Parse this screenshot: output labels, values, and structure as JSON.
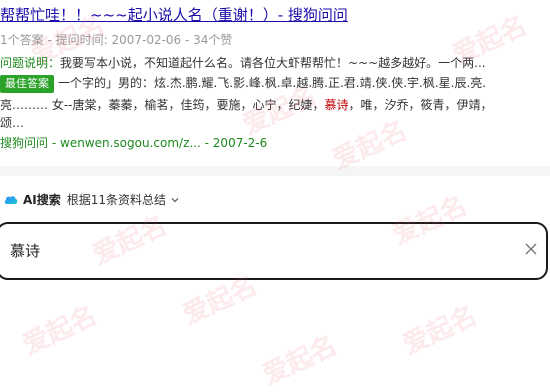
{
  "result": {
    "title": "帮帮忙哇！！~~~起小说人名（重谢！）- 搜狗问问",
    "meta": "1个答案 - 提问时间: 2007-02-06 - 34个赞",
    "question_label": "问题说明：",
    "question_text": "我要写本小说，不知道起什么名。请各位大虾帮帮忙！~~~越多越好。一个两...",
    "best_answer_badge": "最佳答案",
    "answer_line1": "一个字的」男的：炫.杰.鹏.耀.飞.影.峰.枫.卓.越.腾.正.君.靖.侠.侠.宇.枫.星.辰.亮.",
    "answer_line2_before": "亮……… 女--唐棠，蓁蓁，榆茗，佳筠，要施，心宁，纪婕，",
    "answer_line2_highlight": "慕诗",
    "answer_line2_after": "，唯，汐乔，筱青，伊靖，",
    "answer_line3": "颂…",
    "source_name": "搜狗问问",
    "source_url": "wenwen.sogou.com/z...",
    "source_date": "2007-2-6"
  },
  "ai": {
    "label": "AI搜索",
    "summary": "根据11条资料总结"
  },
  "search": {
    "value": "慕诗"
  },
  "watermark": {
    "text": "爱起名",
    "color": "#e65064"
  },
  "icons": {
    "ai": "ai-cloud-icon",
    "chevron": "chevron-down-icon",
    "clear": "clear-icon"
  }
}
